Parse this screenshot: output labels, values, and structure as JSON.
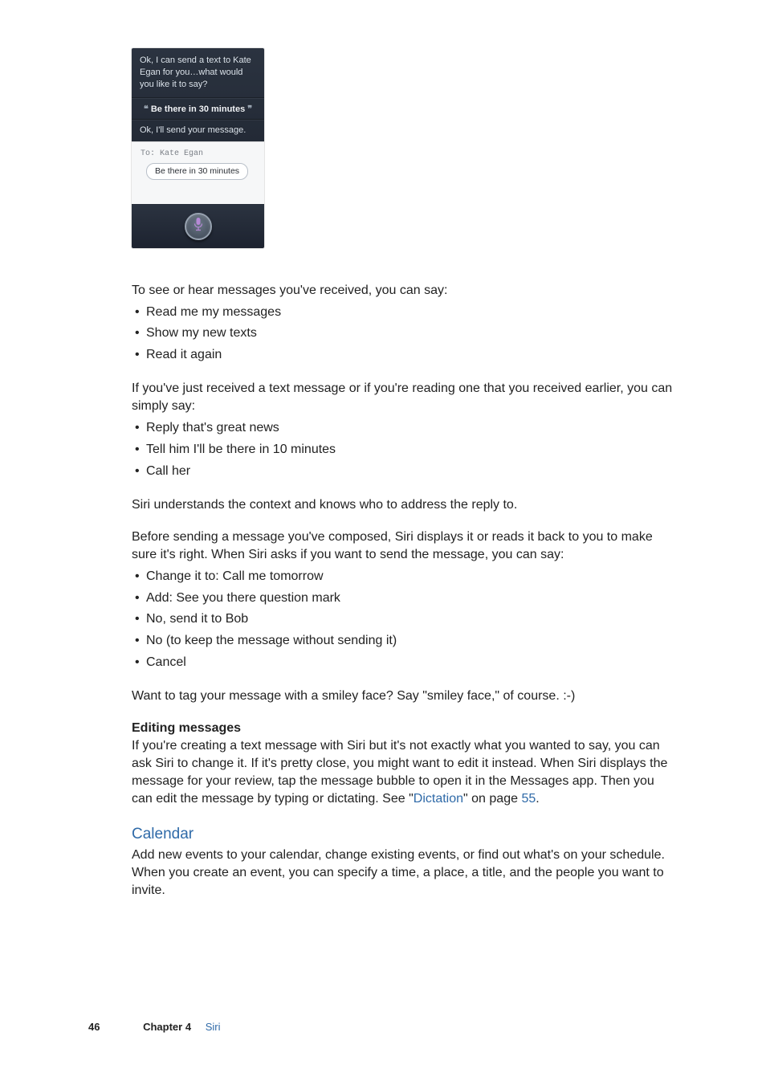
{
  "siri": {
    "reply1": "Ok, I can send a text to Kate Egan for you…what would you like it to say?",
    "quote": "Be there in 30 minutes",
    "confirm": "Ok, I'll send your message.",
    "to_label": "To:",
    "to_name": "Kate Egan",
    "bubble": "Be there in 30 minutes"
  },
  "para1": "To see or hear messages you've received, you can say:",
  "list1": [
    "Read me my messages",
    "Show my new texts",
    "Read it again"
  ],
  "para2": "If you've just received a text message or if you're reading one that you received earlier, you can simply say:",
  "list2": [
    "Reply that's great news",
    "Tell him I'll be there in 10 minutes",
    "Call her"
  ],
  "para3": "Siri understands the context and knows who to address the reply to.",
  "para4": "Before sending a message you've composed, Siri displays it or reads it back to you to make sure it's right. When Siri asks if you want to send the message, you can say:",
  "list3": [
    "Change it to: Call me tomorrow",
    "Add: See you there question mark",
    "No, send it to Bob",
    "No (to keep the message without sending it)",
    "Cancel"
  ],
  "para5": "Want to tag your message with a smiley face? Say \"smiley face,\" of course. :-)",
  "subhead1": "Editing messages",
  "para6_a": "If you're creating a text message with Siri but it's not exactly what you wanted to say, you can ask Siri to change it. If it's pretty close, you might want to edit it instead. When Siri displays the message for your review, tap the message bubble to open it in the Messages app. Then you can edit the message by typing or dictating. See \"",
  "para6_link": "Dictation",
  "para6_b": "\" on page ",
  "para6_page": "55",
  "para6_c": ".",
  "section_title": "Calendar",
  "para7": "Add new events to your calendar, change existing events, or find out what's on your schedule. When you create an event, you can specify a time, a place, a title, and the people you want to invite.",
  "footer": {
    "page": "46",
    "chapter_label": "Chapter 4",
    "chapter_name": "Siri"
  }
}
